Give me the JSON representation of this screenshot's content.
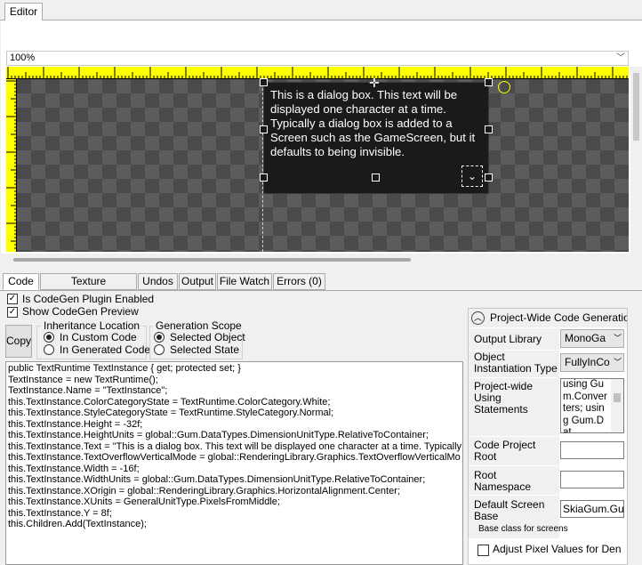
{
  "editor": {
    "tab_label": "Editor",
    "zoom": "100%",
    "dialog_text": "This is a dialog box. This text will be displayed one character at a time. Typically a dialog box is added to a Screen such as the GameScreen, but it defaults to being invisible."
  },
  "bottom_tabs": [
    {
      "label": "Code",
      "active": true
    },
    {
      "label": "Texture Coordinates",
      "active": false
    },
    {
      "label": "Undos",
      "active": false
    },
    {
      "label": "Output",
      "active": false
    },
    {
      "label": "File Watch",
      "active": false
    },
    {
      "label": "Errors (0)",
      "active": false
    }
  ],
  "code_panel": {
    "enabled_label": "Is CodeGen Plugin Enabled",
    "enabled_checked": true,
    "preview_label": "Show CodeGen Preview",
    "preview_checked": true,
    "copy_label": "Copy",
    "inheritance": {
      "title": "Inheritance Location",
      "opt1": "In Custom Code",
      "opt2": "In Generated Code",
      "selected": "In Custom Code"
    },
    "scope": {
      "title": "Generation Scope",
      "opt1": "Selected Object",
      "opt2": "Selected State",
      "selected": "Selected Object"
    },
    "code_lines": [
      "public TextRuntime TextInstance { get; protected set; }",
      "TextInstance = new TextRuntime();",
      "TextInstance.Name = \"TextInstance\";",
      "this.TextInstance.ColorCategoryState = TextRuntime.ColorCategory.White;",
      "this.TextInstance.StyleCategoryState = TextRuntime.StyleCategory.Normal;",
      "this.TextInstance.Height = -32f;",
      "this.TextInstance.HeightUnits = global::Gum.DataTypes.DimensionUnitType.RelativeToContainer;",
      "this.TextInstance.Text = \"This is a dialog box. This text will be displayed one character at a time. Typically a",
      "this.TextInstance.TextOverflowVerticalMode = global::RenderingLibrary.Graphics.TextOverflowVerticalMo",
      "this.TextInstance.Width = -16f;",
      "this.TextInstance.WidthUnits = global::Gum.DataTypes.DimensionUnitType.RelativeToContainer;",
      "this.TextInstance.XOrigin = global::RenderingLibrary.Graphics.HorizontalAlignment.Center;",
      "this.TextInstance.XUnits = GeneralUnitType.PixelsFromMiddle;",
      "this.TextInstance.Y = 8f;",
      "this.Children.Add(TextInstance);"
    ]
  },
  "settings": {
    "header": "Project-Wide Code Generation",
    "output_library_label": "Output Library",
    "output_library_value": "MonoGa",
    "object_instantiation_label": "Object Instantiation Type",
    "object_instantiation_value": "FullyInCo",
    "using_label": "Project-wide Using Statements",
    "using_value": "using Gum.Converters; using Gum.Dat",
    "code_project_root_label": "Code Project Root",
    "code_project_root_value": "",
    "root_namespace_label": "Root Namespace",
    "root_namespace_value": "",
    "default_screen_base_label": "Default Screen Base",
    "default_screen_base_value": "SkiaGum.Gu",
    "default_screen_base_hint": "Base class for screens",
    "adjust_pixel_label": "Adjust Pixel Values for Den",
    "adjust_pixel_checked": false
  }
}
